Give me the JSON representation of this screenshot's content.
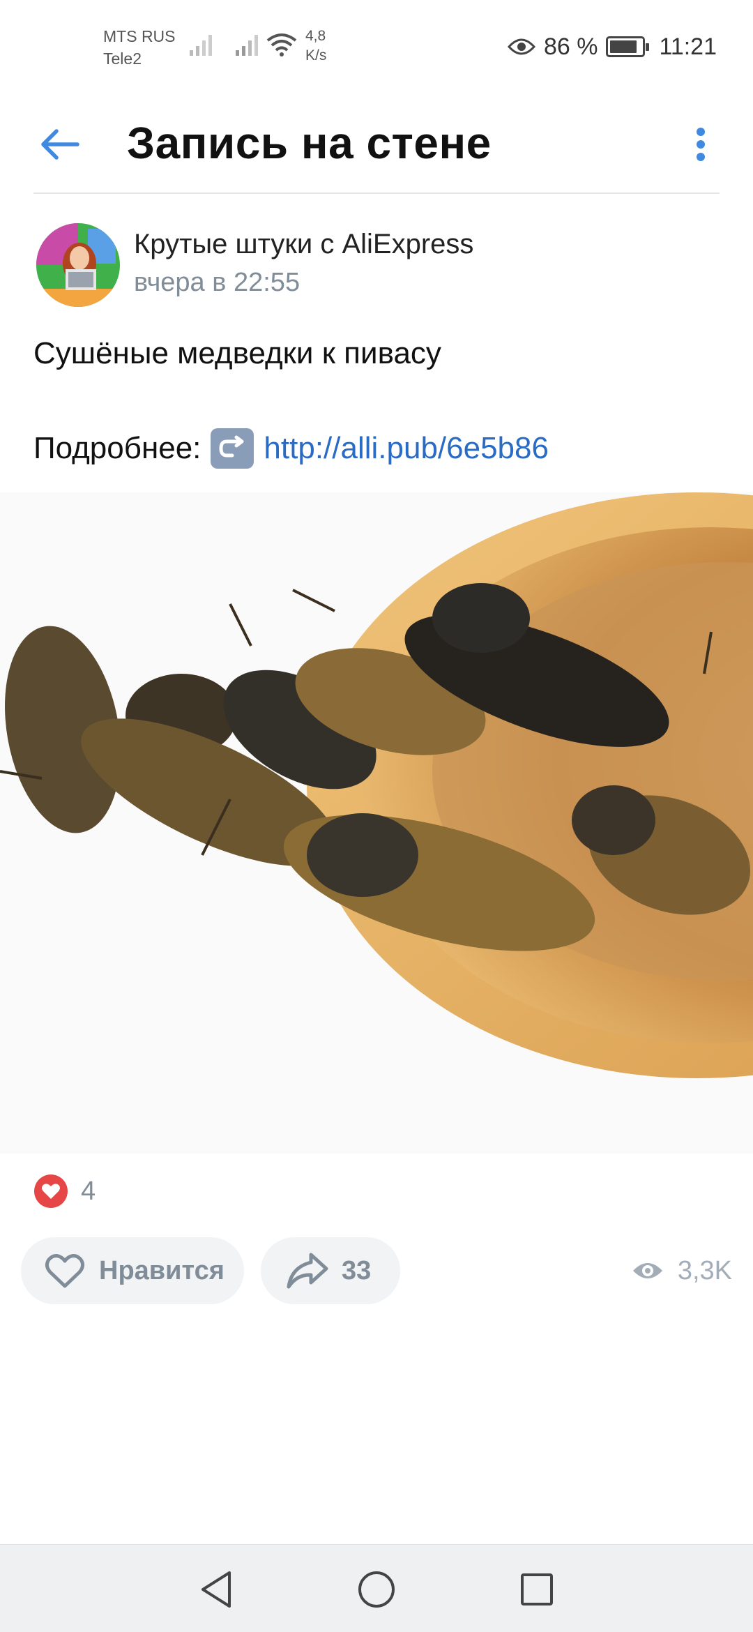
{
  "status_bar": {
    "carrier1": "MTS RUS",
    "carrier2": "Tele2",
    "speed_value": "4,8",
    "speed_unit": "K/s",
    "battery": "86 %",
    "time": "11:21",
    "battery_level": 0.86
  },
  "header": {
    "title": "Запись на стене",
    "back_icon": "arrow-left-icon",
    "more_icon": "more-vertical-icon",
    "accent": "#3f8ae0"
  },
  "post": {
    "author": "Крутые штуки с AliExpress",
    "time": "вчера в 22:55",
    "text": "Сушёные медведки к пивасу",
    "more_label": "Подробнее:",
    "link": "http://alli.pub/6e5b86",
    "emoji": "↪️",
    "reactions_count": "4",
    "like_label": "Нравится",
    "share_count": "33",
    "views": "3,3K"
  },
  "colors": {
    "link": "#2a6cc4",
    "secondary_text": "#818c99",
    "reaction_red": "#e64646",
    "pill_bg": "#f2f3f5"
  }
}
